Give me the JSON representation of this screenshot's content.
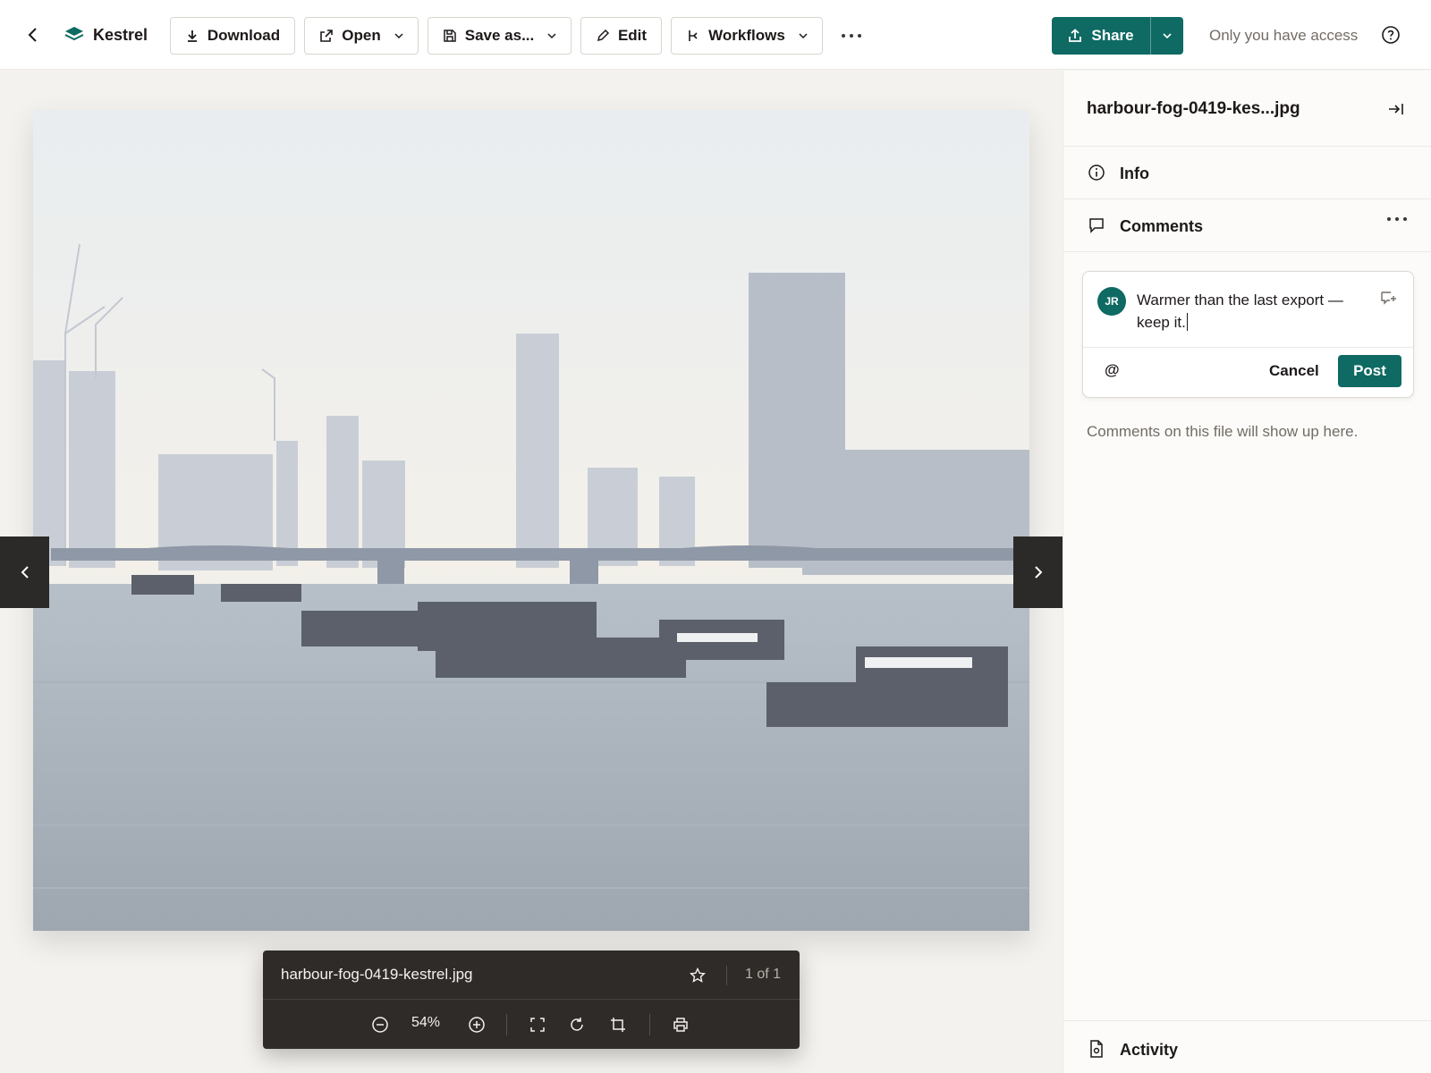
{
  "topbar": {
    "app_name": "Kestrel",
    "buttons": {
      "download": "Download",
      "open": "Open",
      "save_as": "Save as...",
      "edit": "Edit",
      "workflows": "Workflows"
    },
    "share_label": "Share",
    "access_text": "Only you have access"
  },
  "viewer": {
    "filename": "harbour-fog-0419-kestrel.jpg",
    "page_indicator": "1 of 1",
    "zoom": "54%"
  },
  "panel": {
    "title": "harbour-fog-0419-kes...jpg",
    "info_label": "Info",
    "comments_label": "Comments",
    "compose": {
      "avatar_initials": "JR",
      "draft_text": "Warmer than the last export — keep it.",
      "mention_symbol": "@",
      "cancel_label": "Cancel",
      "post_label": "Post"
    },
    "empty_note": "Comments on this file will show up here.",
    "activity_label": "Activity"
  },
  "colors": {
    "accent": "#0e6a62",
    "toolbar_dark": "#2e2b28"
  }
}
